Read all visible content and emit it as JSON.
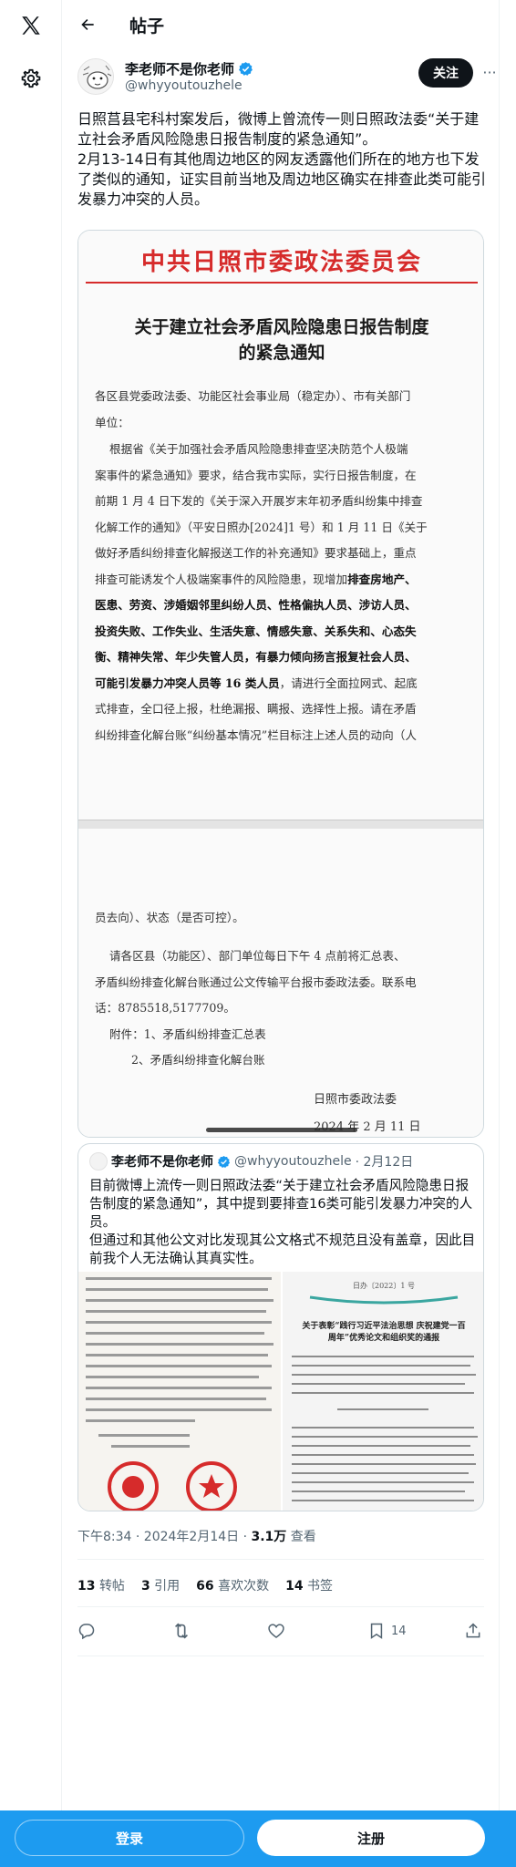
{
  "app": {
    "logo": "x-logo-icon"
  },
  "nav": {
    "settings_icon": "gear-icon",
    "back_icon": "arrow-left-icon"
  },
  "header": {
    "title": "帖子"
  },
  "post": {
    "author_name": "李老师不是你老师",
    "author_handle": "@whyyoutouzhele",
    "verified": true,
    "follow_label": "关注",
    "more_label": "···",
    "text": "日照莒县宅科村案发后，微博上曾流传一则日照政法委“关于建立社会矛盾风险隐患日报告制度的紧急通知”。\n2月13-14日有其他周边地区的网友透露他们所在的地方也下发了类似的通知，证实目前当地及周边地区确实在排查此类可能引发暴力冲突的人员。",
    "timestamp": "下午8:34 · 2024年2月14日 · ",
    "views_count": "3.1万",
    "views_label": " 查看"
  },
  "document": {
    "header": "中共日照市委政法委员会",
    "title_line1": "关于建立社会矛盾风险隐患日报告制度",
    "title_line2": "的紧急通知",
    "recipients": "各区县党委政法委、功能区社会事业局（稳定办）、市有关部门\n单位：",
    "para1_start": "    根据省《关于加强社会矛盾风险隐患排查坚决防范个人极端\n案事件的紧急通知》要求，结合我市实际，实行日报告制度，在\n前期 1 月 4 日下发的《关于深入开展岁末年初矛盾纠纷集中排查\n化解工作的通知》（平安日照办[2024]1 号）和 1 月 11 日《关于\n做好矛盾纠纷排查化解报送工作的补充通知》要求基础上，重点\n排查可能诱发个人极端案事件的风险隐患，现增加",
    "para1_bold": "排查房地产、\n医患、劳资、涉婚姻邻里纠纷人员、性格偏执人员、涉访人员、\n投资失败、工作失业、生活失意、情感失意、关系失和、心态失\n衡、精神失常、年少失管人员，有暴力倾向扬言报复社会人员、\n可能引发暴力冲突人员等 16 类人员",
    "para1_end": "，请进行全面拉网式、起底\n式排查，全口径上报，杜绝漏报、瞒报、选择性上报。请在矛盾\n纠纷排查化解台账“纠纷基本情况”栏目标注上述人员的动向（人",
    "continuation": "员去向）、状态（是否可控）。",
    "para2": "    请各区县（功能区）、部门单位每日下午 4 点前将汇总表、\n矛盾纠纷排查化解台账通过公文传输平台报市委政法委。联系电\n话：8785518,5177709。",
    "attach1": "    附件：1、矛盾纠纷排查汇总表",
    "attach2": "          2、矛盾纠纷排查化解台账",
    "sign_org": "日照市委政法委",
    "sign_date": "2024 年 2 月 11 日"
  },
  "quote": {
    "author_name": "李老师不是你老师",
    "author_handle": "@whyyoutouzhele",
    "date": " · 2月12日",
    "verified": true,
    "text": "目前微博上流传一则日照政法委“关于建立社会矛盾风险隐患日报告制度的紧急通知”，其中提到要排查16类可能引发暴力冲突的人员。\n但通过和其他公文对比发现其公文格式不规范且没有盖章，因此目前我个人无法确认其真实性。",
    "img2_doc_no": "日办〔2022〕1 号",
    "img2_title": "关于表彰“践行习近平法治思想 庆祝建党一百周年”优秀论文和组织奖的通报"
  },
  "stats": {
    "retweets_count": "13",
    "retweets_label": "转帖",
    "quotes_count": "3",
    "quotes_label": "引用",
    "likes_count": "66",
    "likes_label": "喜欢次数",
    "bookmarks_count": "14",
    "bookmarks_label": "书签"
  },
  "actions": {
    "reply_icon": "reply-icon",
    "retweet_icon": "retweet-icon",
    "like_icon": "heart-icon",
    "bookmark_icon": "bookmark-icon",
    "bookmark_count": "14",
    "share_icon": "share-icon"
  },
  "bottom_bar": {
    "login_label": "登录",
    "signup_label": "注册"
  },
  "colors": {
    "accent": "#1d9bf0",
    "verified": "#1d9bf0",
    "doc_red": "#d62b2b",
    "text": "#0f1419",
    "muted": "#536471"
  }
}
